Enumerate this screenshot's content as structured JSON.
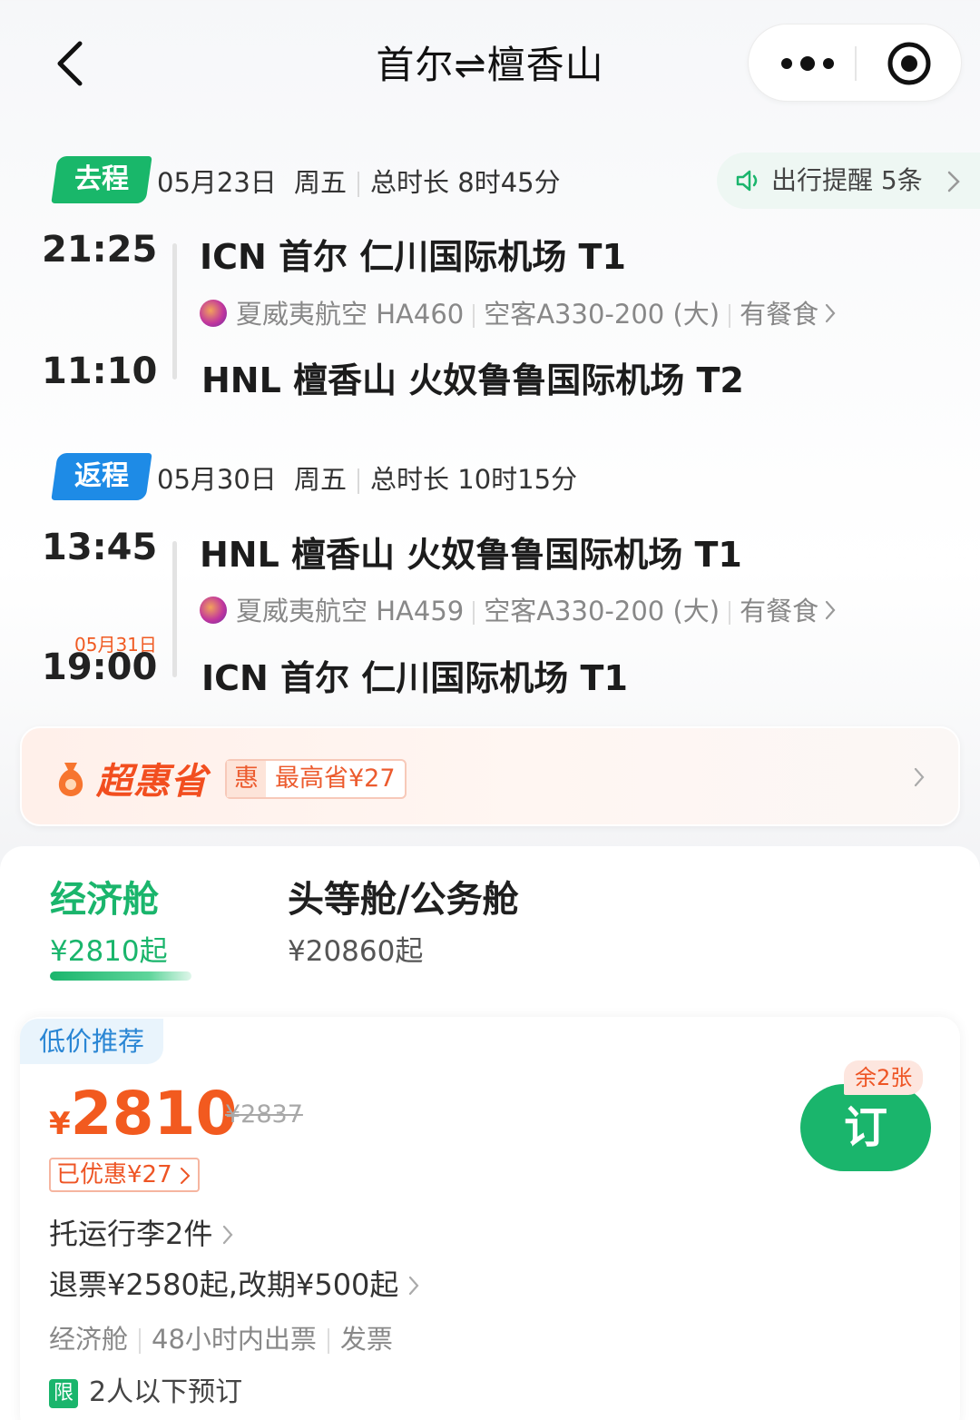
{
  "header": {
    "title": "首尔⇌檀香山"
  },
  "outbound": {
    "tag": "去程",
    "date": "05月23日",
    "weekday": "周五",
    "duration": "总时长 8时45分",
    "reminder": "出行提醒 5条",
    "depart_time": "21:25",
    "depart_airport": "ICN 首尔 仁川国际机场 T1",
    "airline": "夏威夷航空 HA460",
    "aircraft": "空客A330-200 (大)",
    "meal": "有餐食",
    "arrive_time": "11:10",
    "arrive_airport": "HNL 檀香山 火奴鲁鲁国际机场 T2"
  },
  "return": {
    "tag": "返程",
    "date": "05月30日",
    "weekday": "周五",
    "duration": "总时长 10时15分",
    "depart_time": "13:45",
    "depart_airport": "HNL 檀香山 火奴鲁鲁国际机场 T1",
    "airline": "夏威夷航空 HA459",
    "aircraft": "空客A330-200 (大)",
    "meal": "有餐食",
    "arrive_date_note": "05月31日",
    "arrive_time": "19:00",
    "arrive_airport": "ICN 首尔 仁川国际机场 T1"
  },
  "promo": {
    "brand": "超惠省",
    "badge_prefix": "惠",
    "badge_text": "最高省¥27"
  },
  "cabins": [
    {
      "name": "经济舱",
      "price": "¥2810起",
      "active": true
    },
    {
      "name": "头等舱/公务舱",
      "price": "¥20860起",
      "active": false
    }
  ],
  "offer": {
    "tag": "低价推荐",
    "currency": "¥",
    "price": "2810",
    "original_price": "¥2837",
    "saved": "已优惠¥27",
    "baggage": "托运行李2件",
    "refund": "退票¥2580起,改期¥500起",
    "meta": [
      "经济舱",
      "48小时内出票",
      "发票"
    ],
    "limit_badge": "限",
    "limit_text": "2人以下预订",
    "book_label": "订",
    "remaining": "余2张"
  },
  "colors": {
    "green": "#1ab56c",
    "blue": "#1e8be6",
    "orange": "#f25a1f"
  }
}
